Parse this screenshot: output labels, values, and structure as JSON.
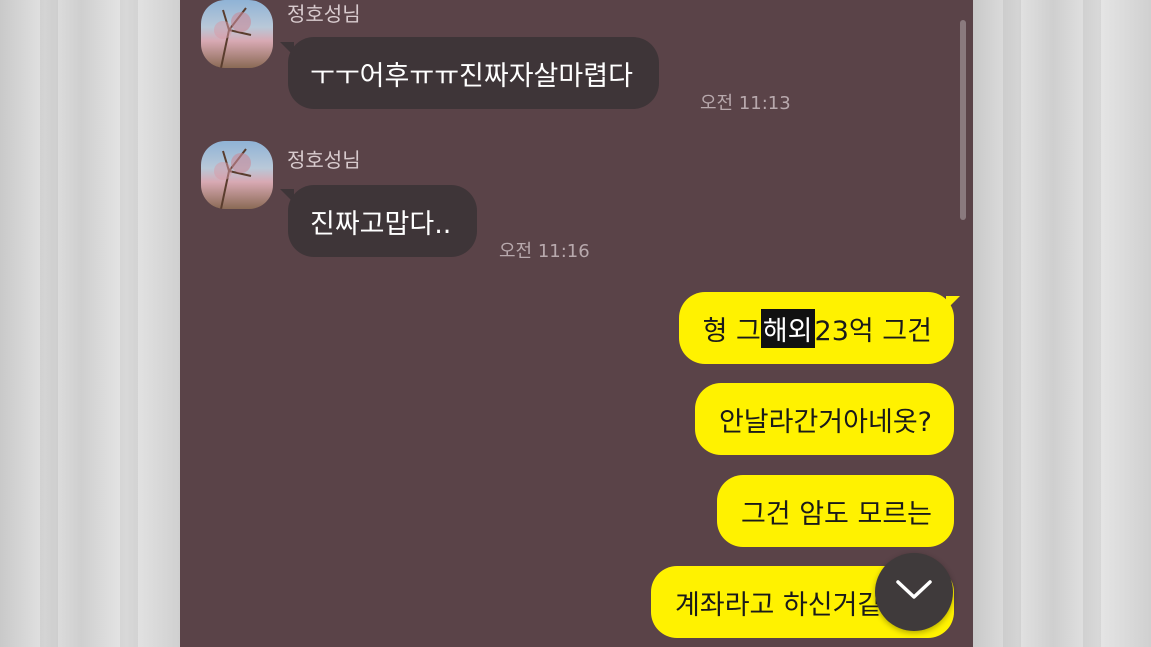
{
  "conversation": {
    "incoming": [
      {
        "sender": "정호성님",
        "text": "ㅜㅜ어후ㅠㅠ진짜자살마렵다",
        "time": "오전 11:13"
      },
      {
        "sender": "정호성님",
        "text": "진짜고맙다..",
        "time": "오전 11:16"
      }
    ],
    "outgoing": [
      {
        "before": "형 그 ",
        "highlight": "해외",
        "after": " 23억 그건"
      },
      {
        "text": "안날라간거아네옷?"
      },
      {
        "text": "그건 암도 모르는"
      },
      {
        "text": "계좌라고 하신거같은데"
      }
    ]
  },
  "controls": {
    "scroll_down_icon": "chevron-down-icon"
  },
  "colors": {
    "chat_bg": "#5a4348",
    "incoming_bubble": "#3e3538",
    "outgoing_bubble": "#fff200"
  }
}
